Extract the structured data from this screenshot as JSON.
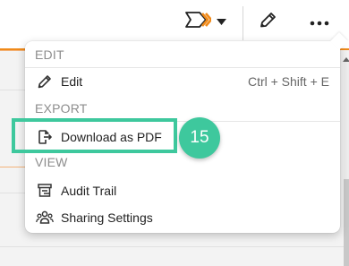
{
  "toolbar": {
    "workflow_icon": "workflow-chevron-icon",
    "caret_icon": "caret-down-icon",
    "edit_icon": "pencil-icon",
    "more_icon": "more-horizontal-icon",
    "accent_color": "#f08a1a"
  },
  "menu": {
    "sections": [
      {
        "header": "EDIT",
        "items": [
          {
            "icon": "pencil-icon",
            "label": "Edit",
            "shortcut": "Ctrl + Shift + E"
          }
        ]
      },
      {
        "header": "EXPORT",
        "items": [
          {
            "icon": "export-file-icon",
            "label": "Download as PDF"
          }
        ]
      },
      {
        "header": "VIEW",
        "items": [
          {
            "icon": "audit-trail-icon",
            "label": "Audit Trail"
          },
          {
            "icon": "sharing-users-icon",
            "label": "Sharing Settings"
          }
        ]
      }
    ]
  },
  "callout": {
    "step_number": "15",
    "color": "#3ec89d"
  }
}
